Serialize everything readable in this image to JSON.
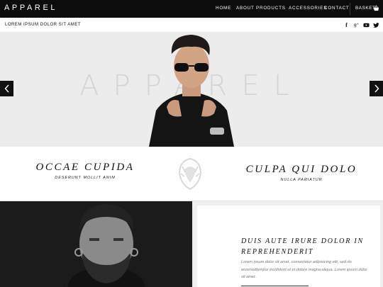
{
  "brand": {
    "logo": "APPAREL"
  },
  "nav": {
    "items": [
      "HOME",
      "ABOUT",
      "PRODUCTS",
      "ACCESSORIES",
      "CONTACT"
    ],
    "basket": "BASKET"
  },
  "subbar": {
    "tagline": "LOREM IPSUM DOLOR SIT AMET",
    "social_icons": [
      "facebook-icon",
      "google-plus-icon",
      "youtube-icon",
      "twitter-icon"
    ]
  },
  "hero": {
    "watermark": "APPAREL"
  },
  "banner": {
    "left_title": "OCCAE CUPIDA",
    "left_sub": "DESERUNT MOLLIT ANIM",
    "right_title": "CULPA QUI DOLO",
    "right_sub": "NULLA PARIATUR"
  },
  "feature": {
    "title": "DUIS AUTE IRURE DOLOR IN REPREHENDERIT",
    "text": "Lorem ipsum dolor sit amet, consectetur adipisicing elit, sed do eiusmodtempor incididunt ut et dolore magna aliqua. Lorem ipsum dolor sit amet."
  },
  "colors": {
    "nav_bg": "#0c0c0c",
    "hero_bg": "#ececec",
    "accent": "#111111"
  }
}
